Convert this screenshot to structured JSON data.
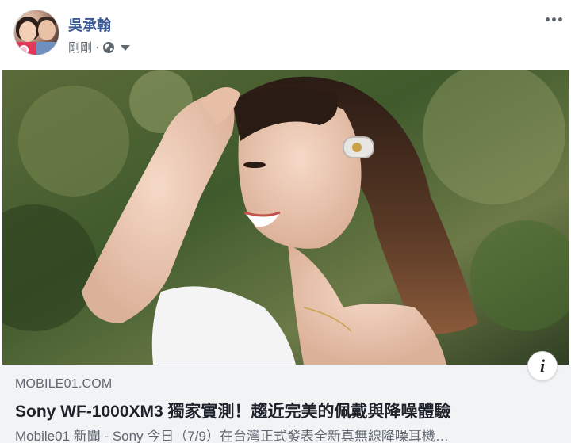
{
  "post": {
    "author_name": "吳承翰",
    "timestamp": "剛剛",
    "separator": "·",
    "privacy_icon": "globe-icon",
    "audience_menu_icon": "caret-down-icon",
    "more_options_icon": "more-horizontal-icon"
  },
  "link_preview": {
    "domain": "MOBILE01.COM",
    "title": "Sony WF-1000XM3 獨家實測！趨近完美的佩戴與降噪體驗",
    "description": "Mobile01 新聞 - Sony 今日（7/9）在台灣正式發表全新真無線降噪耳機…",
    "info_icon_label": "i"
  },
  "colors": {
    "author": "#385898",
    "meta_text": "#616770",
    "link_bg": "#f2f3f5",
    "title_text": "#1d2129"
  }
}
